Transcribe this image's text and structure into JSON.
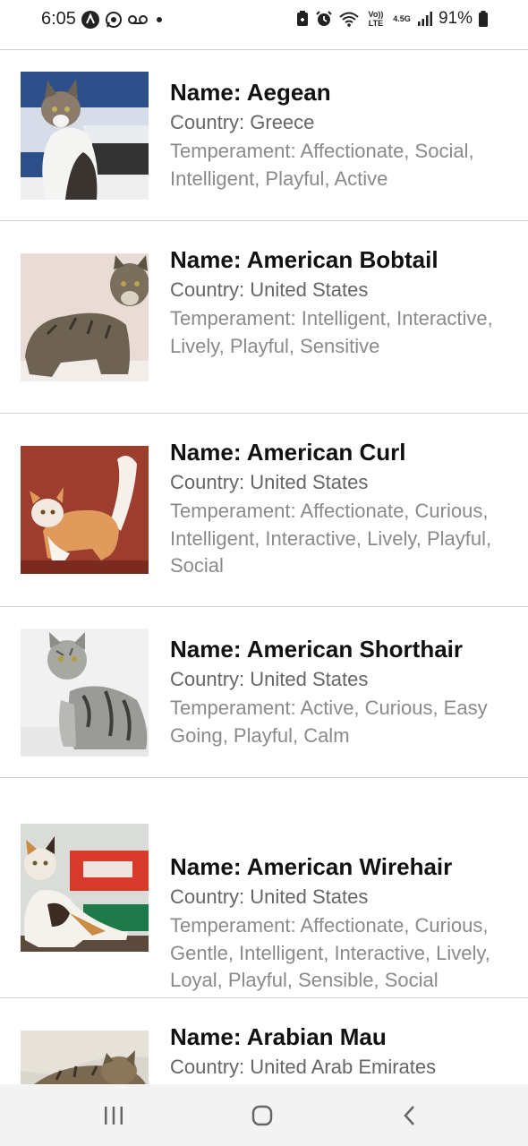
{
  "status_bar": {
    "time": "6:05",
    "left_icons": [
      "app-a-icon",
      "whatsapp-icon",
      "voicemail-icon",
      "dot-icon"
    ],
    "right_icons": [
      "battery-saver-icon",
      "alarm-icon",
      "wifi-icon",
      "volte-icon",
      "data-4g-icon",
      "signal-icon",
      "battery-icon"
    ],
    "volte_label": "Vo)) LTE",
    "network_label": "4.5G",
    "battery_percent": "91%"
  },
  "breeds": [
    {
      "name": "Name: Aegean",
      "country": "Country: Greece",
      "temperament": "Temperament: Affectionate, Social, Intelligent, Playful, Active"
    },
    {
      "name": "Name: American Bobtail",
      "country": "Country: United States",
      "temperament": "Temperament: Intelligent, Interactive, Lively, Playful, Sensitive"
    },
    {
      "name": "Name: American Curl",
      "country": "Country: United States",
      "temperament": "Temperament: Affectionate, Curious, Intelligent, Interactive, Lively, Playful, Social"
    },
    {
      "name": "Name: American Shorthair",
      "country": "Country: United States",
      "temperament": "Temperament: Active, Curious, Easy Going, Playful, Calm"
    },
    {
      "name": "Name: American Wirehair",
      "country": "Country: United States",
      "temperament": "Temperament: Affectionate, Curious, Gentle, Intelligent, Interactive, Lively, Loyal, Playful, Sensible, Social"
    },
    {
      "name": "Name: Arabian Mau",
      "country": "Country: United Arab Emirates",
      "temperament": ""
    }
  ],
  "nav_bar": {
    "buttons": [
      "recent-apps-icon",
      "home-icon",
      "back-icon"
    ]
  }
}
